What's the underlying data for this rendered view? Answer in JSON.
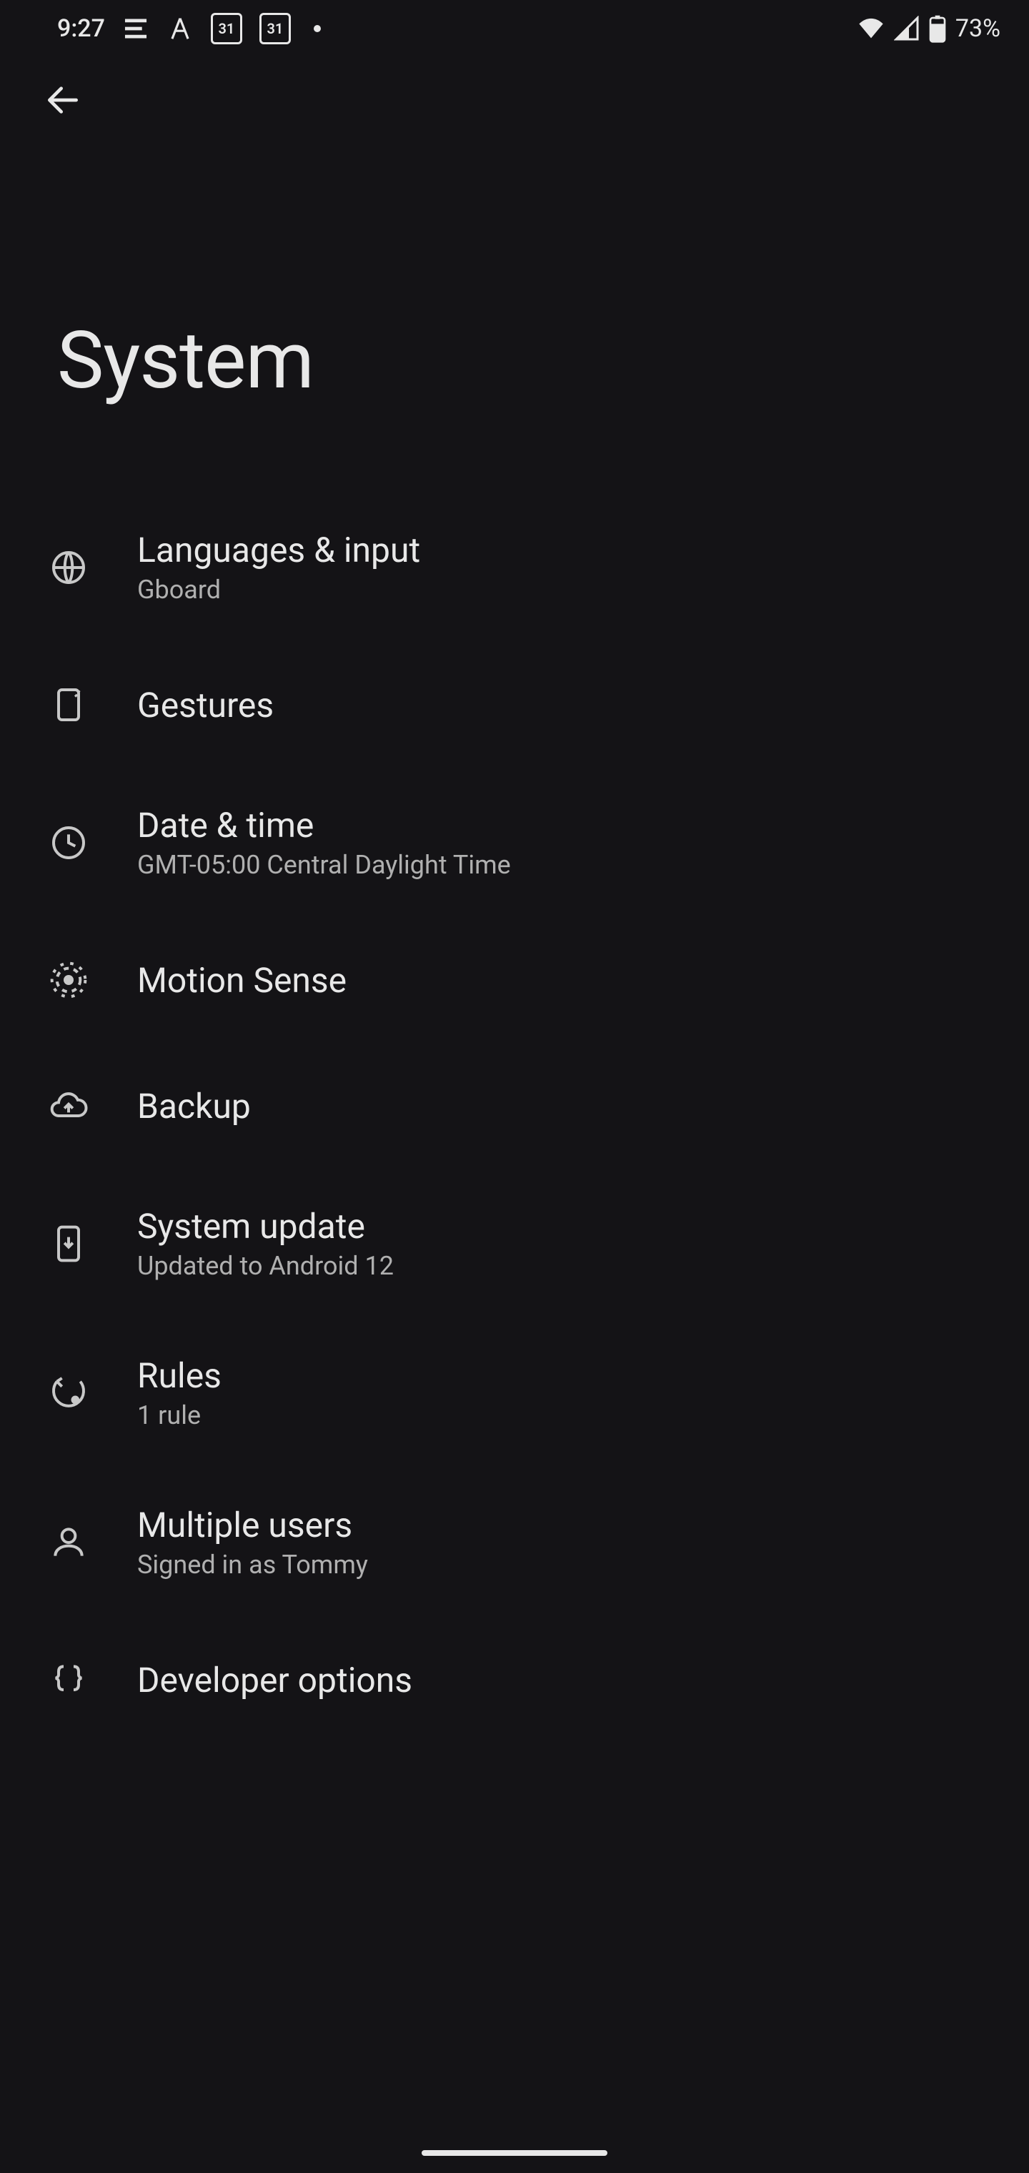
{
  "status": {
    "time": "9:27",
    "cal1": "31",
    "cal2": "31",
    "battery": "73%"
  },
  "page": {
    "title": "System"
  },
  "items": [
    {
      "label": "Languages & input",
      "sub": "Gboard"
    },
    {
      "label": "Gestures",
      "sub": ""
    },
    {
      "label": "Date & time",
      "sub": "GMT-05:00 Central Daylight Time"
    },
    {
      "label": "Motion Sense",
      "sub": ""
    },
    {
      "label": "Backup",
      "sub": ""
    },
    {
      "label": "System update",
      "sub": "Updated to Android 12"
    },
    {
      "label": "Rules",
      "sub": "1 rule"
    },
    {
      "label": "Multiple users",
      "sub": "Signed in as Tommy"
    },
    {
      "label": "Developer options",
      "sub": ""
    }
  ]
}
